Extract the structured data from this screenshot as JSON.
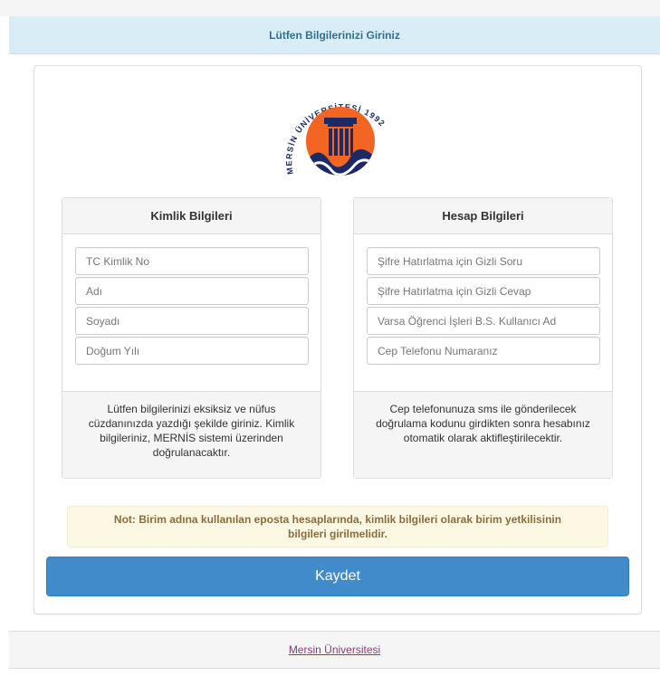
{
  "header": {
    "title": "Lütfen Bilgilerinizi Giriniz"
  },
  "logo": {
    "arc_text": "MERSİN ÜNİVERSİTESİ 1992",
    "colors": {
      "orange": "#f26522",
      "navy": "#1b2a66"
    }
  },
  "identity": {
    "title": "Kimlik Bilgileri",
    "fields": [
      {
        "placeholder": "TC Kimlik No",
        "value": ""
      },
      {
        "placeholder": "Adı",
        "value": ""
      },
      {
        "placeholder": "Soyadı",
        "value": ""
      },
      {
        "placeholder": "Doğum Yılı",
        "value": ""
      }
    ],
    "info": "Lütfen bilgilerinizi eksiksiz ve nüfus cüzdanınızda yazdığı şekilde giriniz. Kimlik bilgileriniz, MERNİS sistemi üzerinden doğrulanacaktır."
  },
  "account": {
    "title": "Hesap Bilgileri",
    "fields": [
      {
        "placeholder": "Şifre Hatırlatma için Gizli Soru",
        "value": ""
      },
      {
        "placeholder": "Şifre Hatırlatma için Gizli Cevap",
        "value": ""
      },
      {
        "placeholder": "Varsa Öğrenci İşleri B.S. Kullanıcı Ad",
        "value": ""
      },
      {
        "placeholder": "Cep Telefonu Numaranız",
        "value": ""
      }
    ],
    "info": "Cep telefonunuza sms ile gönderilecek doğrulama kodunu girdikten sonra hesabınız otomatik olarak aktifleştirilecektir."
  },
  "note": "Not: Birim adına kullanılan eposta hesaplarında, kimlik bilgileri olarak birim yetkilisinin bilgileri girilmelidir.",
  "save_button": "Kaydet",
  "footer": {
    "link": "Mersin Üniversitesi"
  },
  "colors": {
    "header_bg": "#d9edf7",
    "header_text": "#31708f",
    "note_bg": "#fcf8e3",
    "note_text": "#8a6d3b",
    "primary": "#428bca",
    "footer_link": "#8b3a7a"
  }
}
